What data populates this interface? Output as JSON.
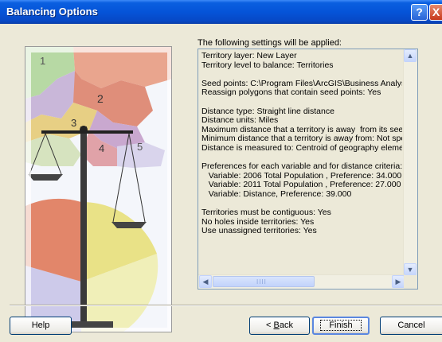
{
  "window": {
    "title": "Balancing Options",
    "help_icon": "?",
    "close_icon": "X"
  },
  "illustration": {
    "region_labels": [
      "1",
      "2",
      "3",
      "4",
      "5"
    ]
  },
  "intro_text": "The following settings will be applied:",
  "settings_text": "Territory layer: New Layer\nTerritory level to balance: Territories\n\nSeed points: C:\\Program Files\\ArcGIS\\Business Analys\nReassign polygons that contain seed points: Yes\n\nDistance type: Straight line distance\nDistance units: Miles\nMaximum distance that a territory is away  from its seed\nMinimum distance that a territory is away from: Not spec\nDistance is measured to: Centroid of geography elemer\n\nPreferences for each variable and for distance criteria:\n   Variable: 2006 Total Population , Preference: 34.000\n   Variable: 2011 Total Population , Preference: 27.000\n   Variable: Distance, Preference: 39.000\n\nTerritories must be contiguous: Yes\nNo holes inside territories: Yes\nUse unassigned territories: Yes",
  "scrollbar": {
    "up": "▲",
    "down": "▼",
    "left": "◀",
    "right": "▶",
    "grip": "IIII"
  },
  "buttons": {
    "help": "Help",
    "back_prefix": "< ",
    "back_key": "B",
    "back_rest": "ack",
    "finish": "Finish",
    "cancel": "Cancel"
  }
}
